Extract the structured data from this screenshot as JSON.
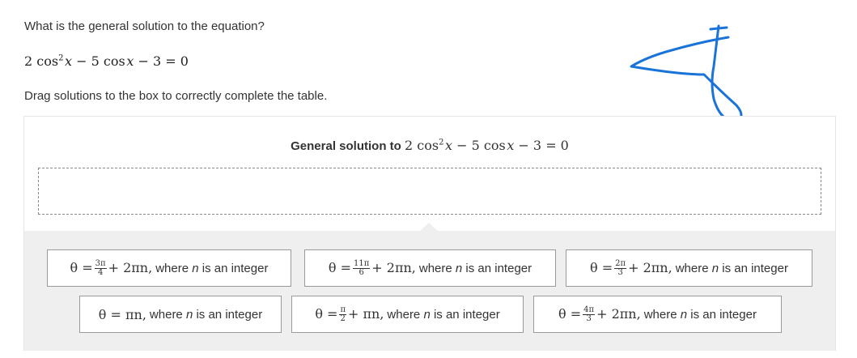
{
  "question": {
    "prompt": "What is the general solution to the equation?",
    "equation": "2 cos² x − 5 cos x − 3 = 0",
    "instruction": "Drag solutions to the box to correctly complete the table."
  },
  "table": {
    "header_label": "General solution to",
    "header_equation": "2 cos² x − 5 cos x − 3 = 0"
  },
  "tiles": [
    {
      "math": "θ = 3π/4 + 2πn,",
      "frac_num": "3π",
      "frac_den": "4",
      "tail": "+ 2πn,",
      "text_pre": "where",
      "var": "n",
      "text_post": "is an integer"
    },
    {
      "math": "θ = 11π/6 + 2πn,",
      "frac_num": "11π",
      "frac_den": "6",
      "tail": "+ 2πn,",
      "text_pre": "where",
      "var": "n",
      "text_post": "is an integer"
    },
    {
      "math": "θ = 2π/3 + 2πn,",
      "frac_num": "2π",
      "frac_den": "3",
      "tail": "+ 2πn,",
      "text_pre": "where",
      "var": "n",
      "text_post": "is an integer"
    },
    {
      "math": "θ = πn,",
      "frac_num": "",
      "frac_den": "",
      "tail": "θ = πn,",
      "text_pre": "where",
      "var": "n",
      "text_post": "is an integer"
    },
    {
      "math": "θ = π/2 + πn,",
      "frac_num": "π",
      "frac_den": "2",
      "tail": "+ πn,",
      "text_pre": "where",
      "var": "n",
      "text_post": "is an integer"
    },
    {
      "math": "θ = 4π/3 + 2πn,",
      "frac_num": "4π",
      "frac_den": "3",
      "tail": "+ 2πn,",
      "text_pre": "where",
      "var": "n",
      "text_post": "is an integer"
    }
  ],
  "colors": {
    "scribble": "#1a73d9",
    "tray": "#efefef",
    "tile_border": "#9a9a9a"
  }
}
